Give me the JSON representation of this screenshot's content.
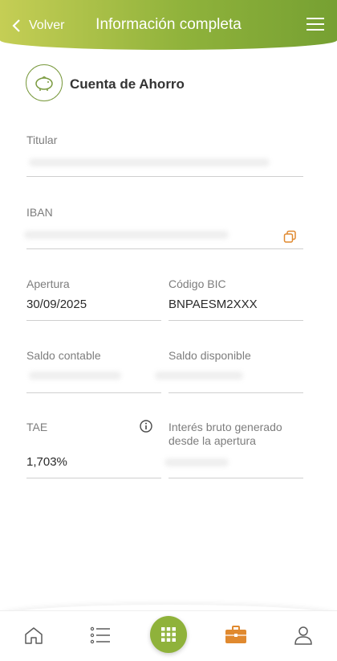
{
  "header": {
    "back_label": "Volver",
    "title": "Información completa"
  },
  "account": {
    "title": "Cuenta de Ahorro"
  },
  "fields": {
    "titular_label": "Titular",
    "iban_label": "IBAN",
    "apertura_label": "Apertura",
    "apertura_value": "30/09/2025",
    "bic_label": "Código BIC",
    "bic_value": "BNPAESM2XXX",
    "saldo_contable_label": "Saldo contable",
    "saldo_disponible_label": "Saldo disponible",
    "tae_label": "TAE",
    "tae_value": "1,703%",
    "interes_label_line1": "Interés bruto generado",
    "interes_label_line2": "desde la apertura"
  },
  "nav": {
    "items": [
      "home-icon",
      "list-icon",
      "grid-icon",
      "briefcase-icon",
      "user-icon"
    ]
  },
  "colors": {
    "accent_green": "#8fb23b",
    "briefcase_orange": "#e0892f"
  }
}
